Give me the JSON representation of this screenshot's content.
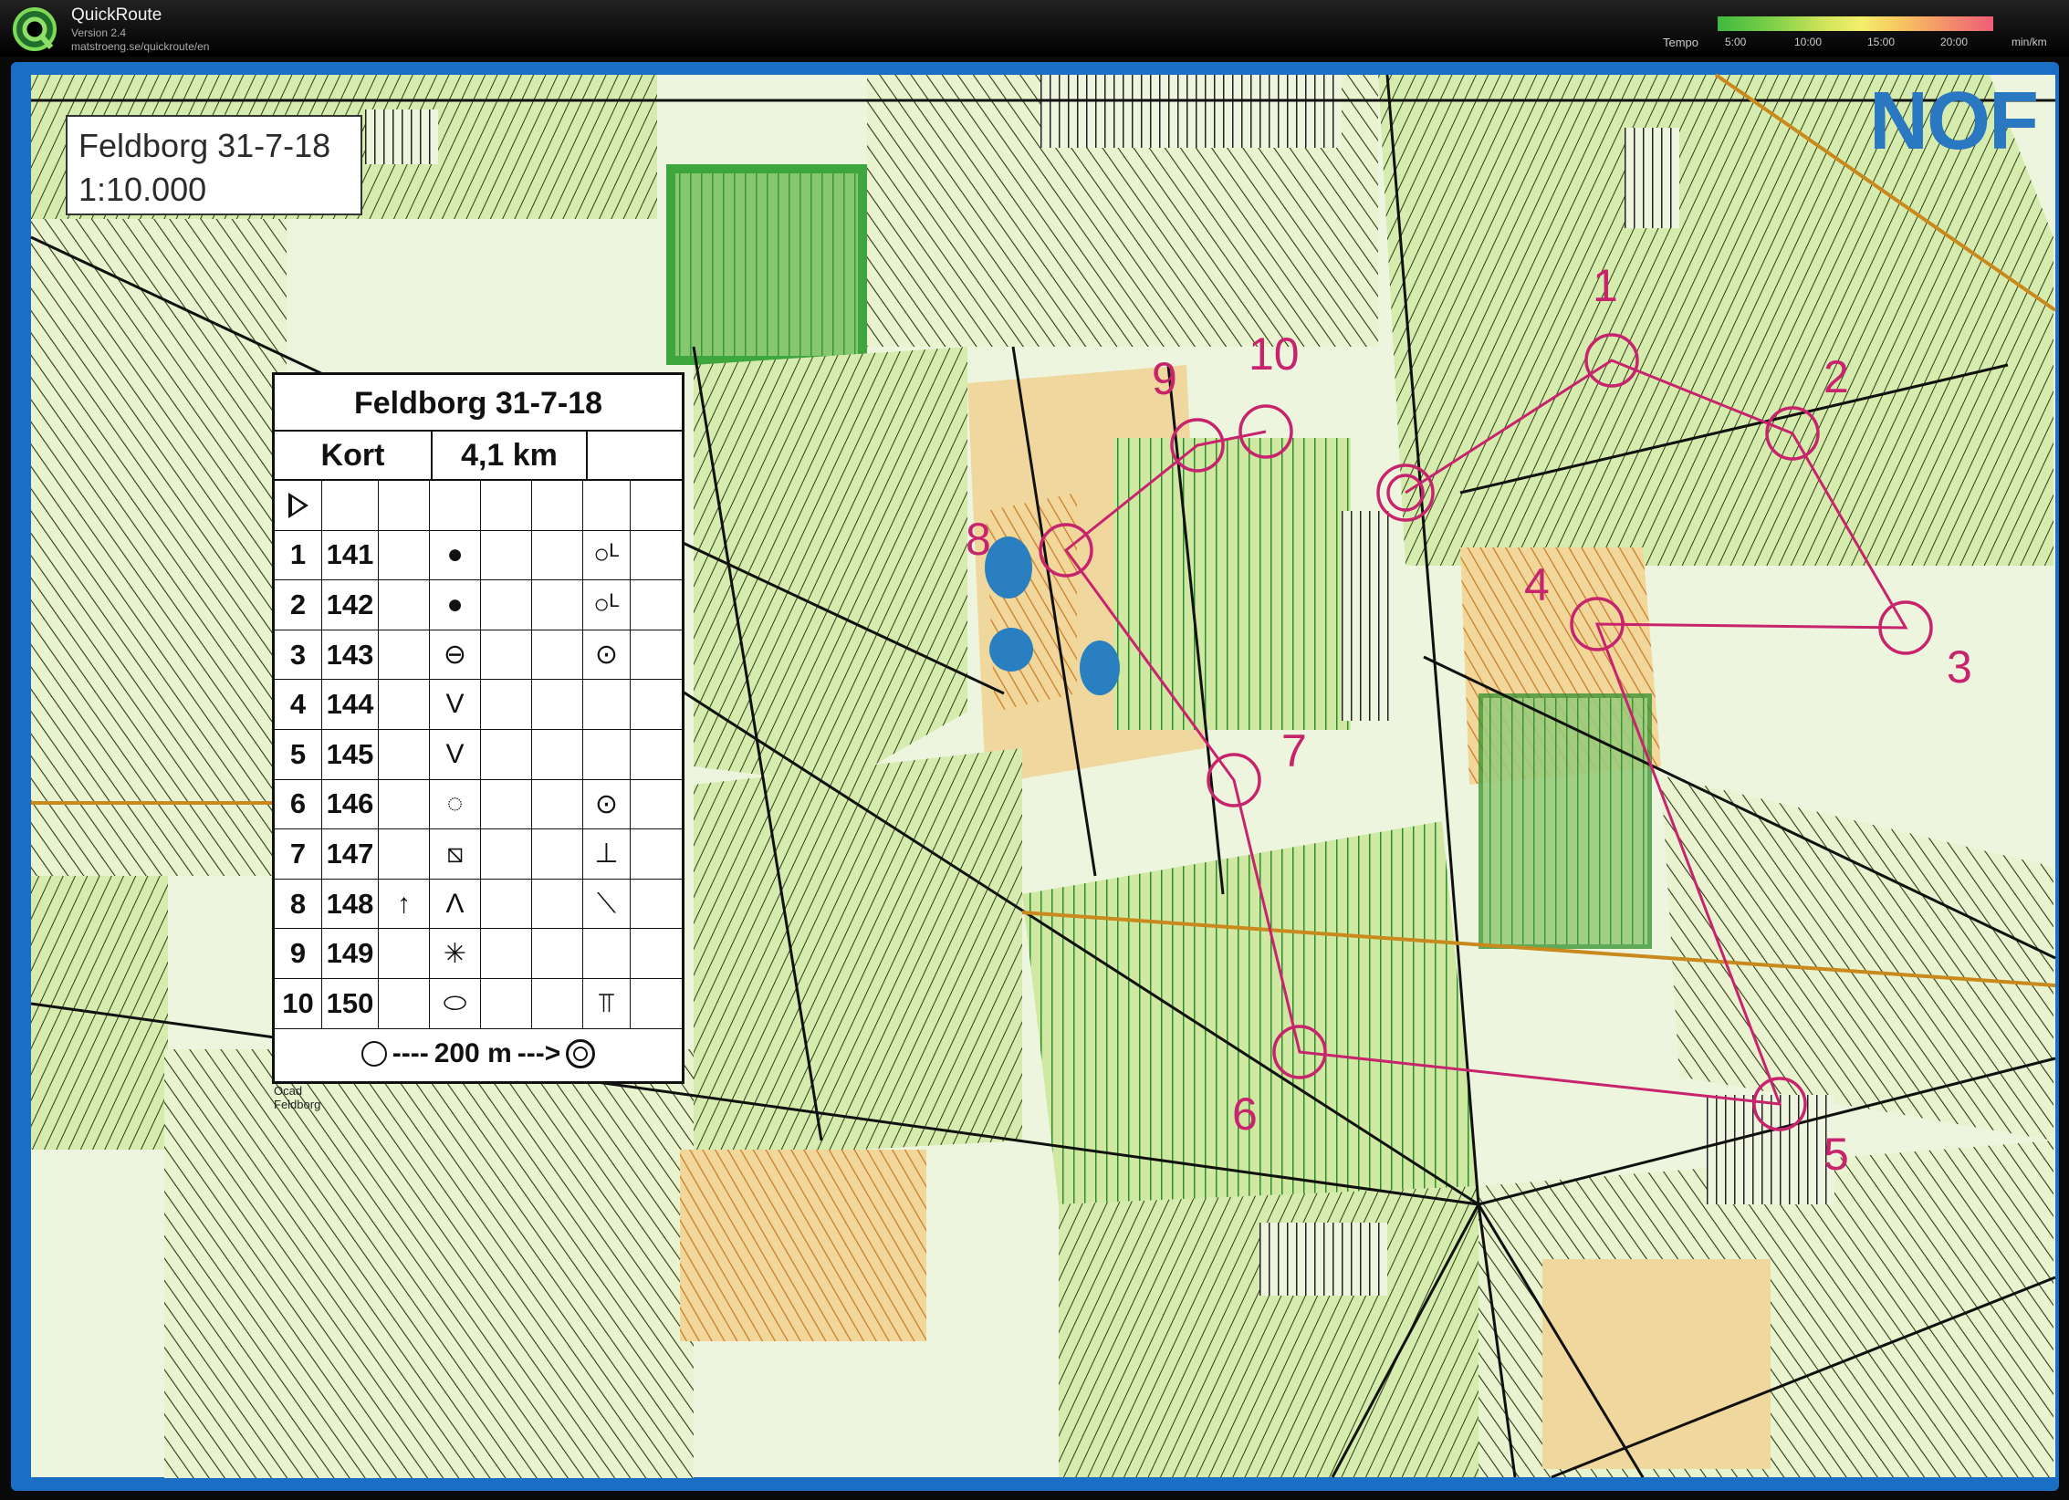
{
  "app": {
    "name": "QuickRoute",
    "version": "Version 2.4",
    "url": "matstroeng.se/quickroute/en"
  },
  "tempo": {
    "label": "Tempo",
    "ticks": [
      "5:00",
      "10:00",
      "15:00",
      "20:00"
    ],
    "unit": "min/km"
  },
  "map": {
    "title": "Feldborg 31-7-18",
    "scale": "1:10.000",
    "corner_text": "NOF",
    "credit_line1": "Ocad",
    "credit_line2": "Feldborg"
  },
  "course": {
    "header": "Feldborg 31-7-18",
    "class": "Kort",
    "length": "4,1 km",
    "controls": [
      {
        "n": "1",
        "code": "141",
        "c4": "",
        "sym": "●",
        "sym2": "○ᴸ"
      },
      {
        "n": "2",
        "code": "142",
        "c4": "",
        "sym": "●",
        "sym2": "○ᴸ"
      },
      {
        "n": "3",
        "code": "143",
        "c4": "",
        "sym": "⊖",
        "sym2": "⊙"
      },
      {
        "n": "4",
        "code": "144",
        "c4": "",
        "sym": "V",
        "sym2": ""
      },
      {
        "n": "5",
        "code": "145",
        "c4": "",
        "sym": "V",
        "sym2": ""
      },
      {
        "n": "6",
        "code": "146",
        "c4": "",
        "sym": "◌",
        "sym2": "⊙"
      },
      {
        "n": "7",
        "code": "147",
        "c4": "",
        "sym": "⧅",
        "sym2": "⊥"
      },
      {
        "n": "8",
        "code": "148",
        "c4": "↑",
        "sym": "Λ",
        "sym2": "⟍"
      },
      {
        "n": "9",
        "code": "149",
        "c4": "",
        "sym": "✳",
        "sym2": ""
      },
      {
        "n": "10",
        "code": "150",
        "c4": "",
        "sym": "⬭",
        "sym2": "⫪"
      }
    ],
    "finish": "200 m",
    "control_labels": [
      "1",
      "2",
      "3",
      "4",
      "5",
      "6",
      "7",
      "8",
      "9",
      "10"
    ]
  },
  "colors": {
    "course": "#c8246e",
    "water": "#2a7fc0",
    "frame": "#1a6fc4"
  }
}
